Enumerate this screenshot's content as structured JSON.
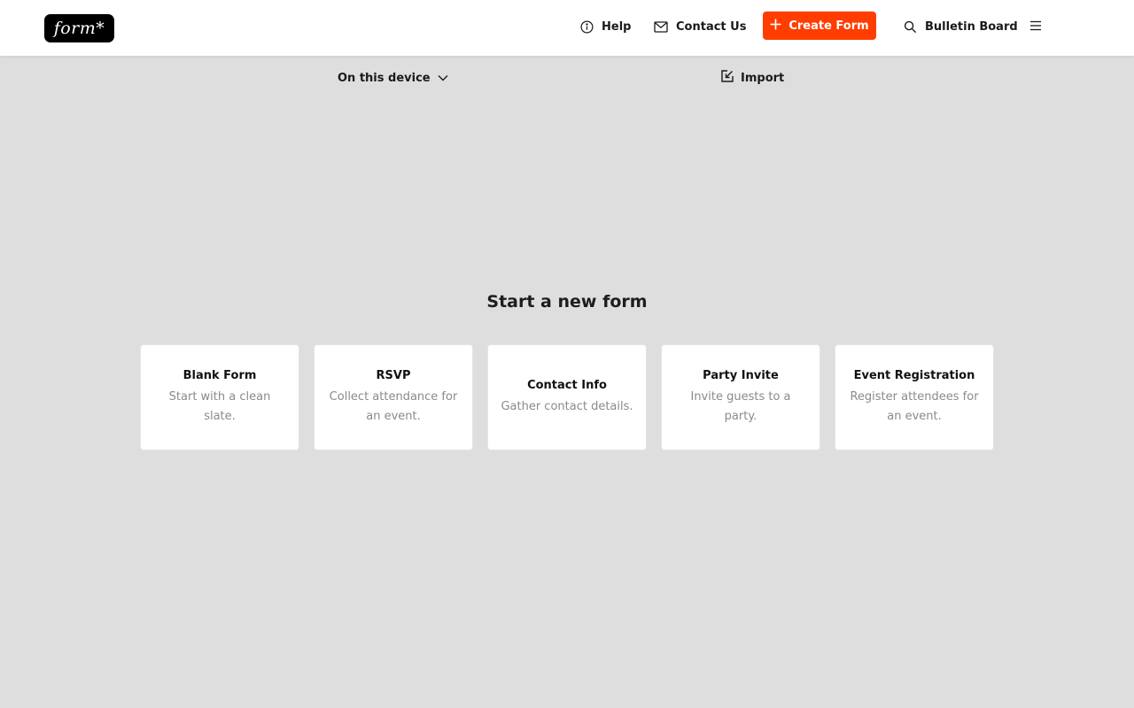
{
  "header": {
    "logo_text": "form*",
    "help_label": "Help",
    "contact_label": "Contact Us",
    "create_label": "Create Form",
    "bulletin_label": "Bulletin Board",
    "accent_color": "#ff3d00"
  },
  "subbar": {
    "device_label": "On this device",
    "import_label": "Import"
  },
  "main": {
    "title": "Start a new form",
    "templates": [
      {
        "title": "Blank Form",
        "description": "Start with a clean slate."
      },
      {
        "title": "RSVP",
        "description": "Collect attendance for an event."
      },
      {
        "title": "Contact Info",
        "description": "Gather contact details."
      },
      {
        "title": "Party Invite",
        "description": "Invite guests to a party."
      },
      {
        "title": "Event Registration",
        "description": "Register attendees for an event."
      }
    ]
  },
  "icons": [
    "info-icon",
    "mail-icon",
    "plus-icon",
    "search-icon",
    "hamburger-menu-icon",
    "chevron-down-icon",
    "import-icon"
  ]
}
